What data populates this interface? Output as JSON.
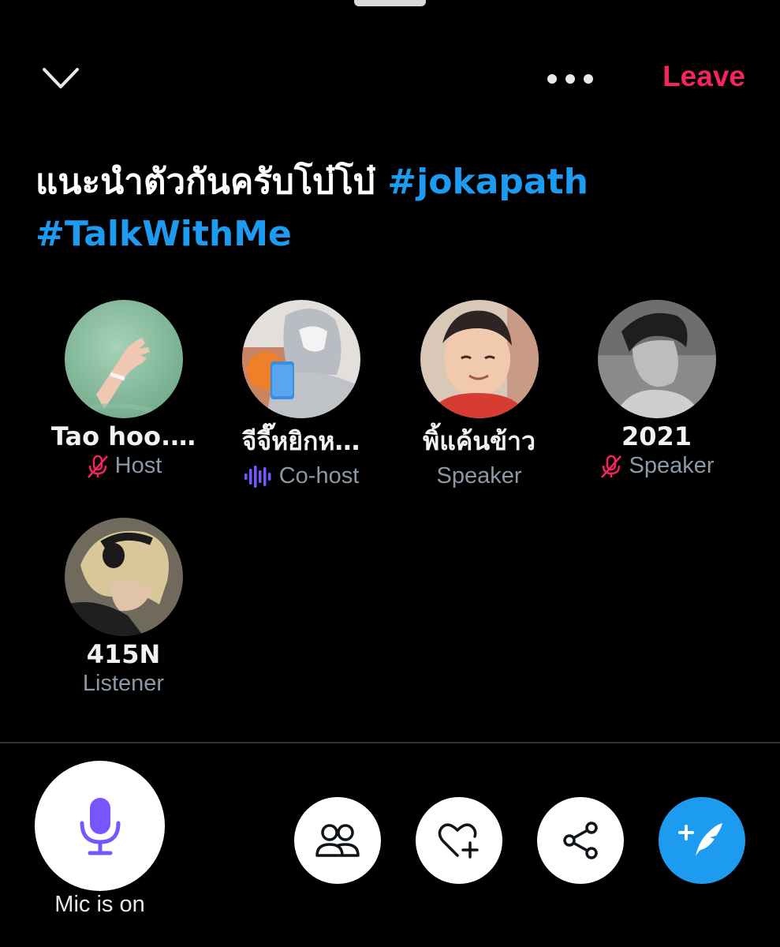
{
  "header": {
    "leave_label": "Leave"
  },
  "space": {
    "title_text": "แนะนำตัวกันครับโบ๋โบ๋ ",
    "hashtags": [
      "#jokapath",
      "#TalkWithMe"
    ]
  },
  "participants": [
    {
      "name": "Tao hoo.…",
      "role": "Host",
      "mic": "muted"
    },
    {
      "name": "จีจี๊หยิกห…",
      "role": "Co-host",
      "mic": "speaking"
    },
    {
      "name": "พิ้แค้นข้าว",
      "role": "Speaker",
      "mic": "none"
    },
    {
      "name": "2021",
      "role": "Speaker",
      "mic": "muted"
    },
    {
      "name": "415N",
      "role": "Listener",
      "mic": "none"
    }
  ],
  "footer": {
    "mic_status": "Mic is on"
  },
  "colors": {
    "accent": "#1d9bf0",
    "leave": "#f4245e",
    "mic": "#7856ff",
    "muted": "#f4245e"
  }
}
